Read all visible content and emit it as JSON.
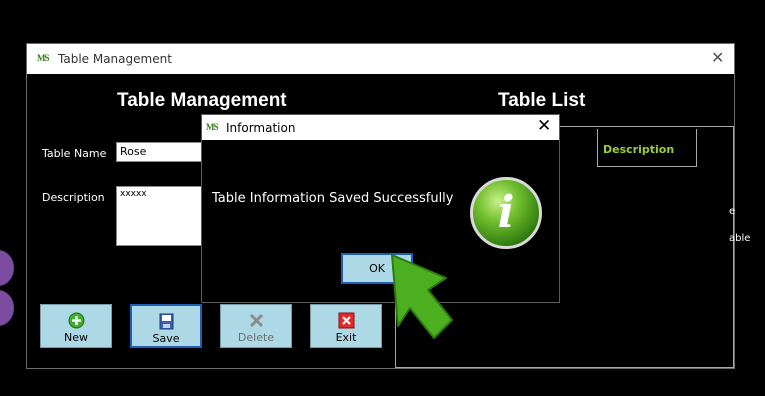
{
  "window": {
    "title": "Table Management",
    "app_icon_text": "MS",
    "close_glyph": "✕"
  },
  "form": {
    "heading": "Table Management",
    "table_name_label": "Table Name",
    "table_name_value": "Rose",
    "description_label": "Description",
    "description_value": "xxxxx"
  },
  "toolbar": {
    "new_label": "New",
    "save_label": "Save",
    "delete_label": "Delete",
    "exit_label": "Exit"
  },
  "table_list": {
    "heading": "Table List",
    "columns": [
      "Description"
    ],
    "partial_texts": [
      "e",
      "able"
    ]
  },
  "dialog": {
    "title": "Information",
    "message": "Table Information Saved Successfully",
    "ok_label": "OK",
    "close_glyph": "✕",
    "icon_letter": "i"
  },
  "colors": {
    "button_bg": "#add8e6",
    "focus_border": "#1e5fb3",
    "header_green": "#9acd32",
    "arrow_green": "#4caf1f",
    "decor_purple": "#7b4ca0"
  }
}
